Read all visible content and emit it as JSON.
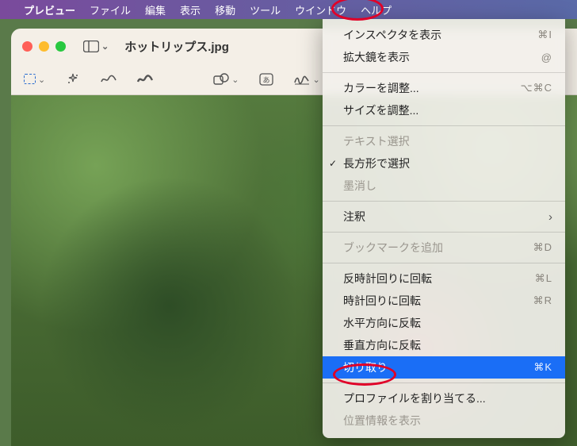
{
  "menubar": {
    "app_name": "プレビュー",
    "items": [
      "ファイル",
      "編集",
      "表示",
      "移動",
      "ツール",
      "ウインドウ",
      "ヘルプ"
    ]
  },
  "window": {
    "title": "ホットリップス.jpg"
  },
  "tools_menu": {
    "show_inspector": {
      "label": "インスペクタを表示",
      "shortcut": "⌘I"
    },
    "show_magnifier": {
      "label": "拡大鏡を表示",
      "shortcut": "@"
    },
    "adjust_color": {
      "label": "カラーを調整...",
      "shortcut": "⌥⌘C"
    },
    "adjust_size": {
      "label": "サイズを調整..."
    },
    "text_select": {
      "label": "テキスト選択"
    },
    "rect_select": {
      "label": "長方形で選択"
    },
    "redact": {
      "label": "墨消し"
    },
    "annotate": {
      "label": "注釈"
    },
    "add_bookmark": {
      "label": "ブックマークを追加",
      "shortcut": "⌘D"
    },
    "rotate_ccw": {
      "label": "反時計回りに回転",
      "shortcut": "⌘L"
    },
    "rotate_cw": {
      "label": "時計回りに回転",
      "shortcut": "⌘R"
    },
    "flip_h": {
      "label": "水平方向に反転"
    },
    "flip_v": {
      "label": "垂直方向に反転"
    },
    "crop": {
      "label": "切り取り",
      "shortcut": "⌘K"
    },
    "assign_profile": {
      "label": "プロファイルを割り当てる..."
    },
    "show_location": {
      "label": "位置情報を表示"
    }
  }
}
